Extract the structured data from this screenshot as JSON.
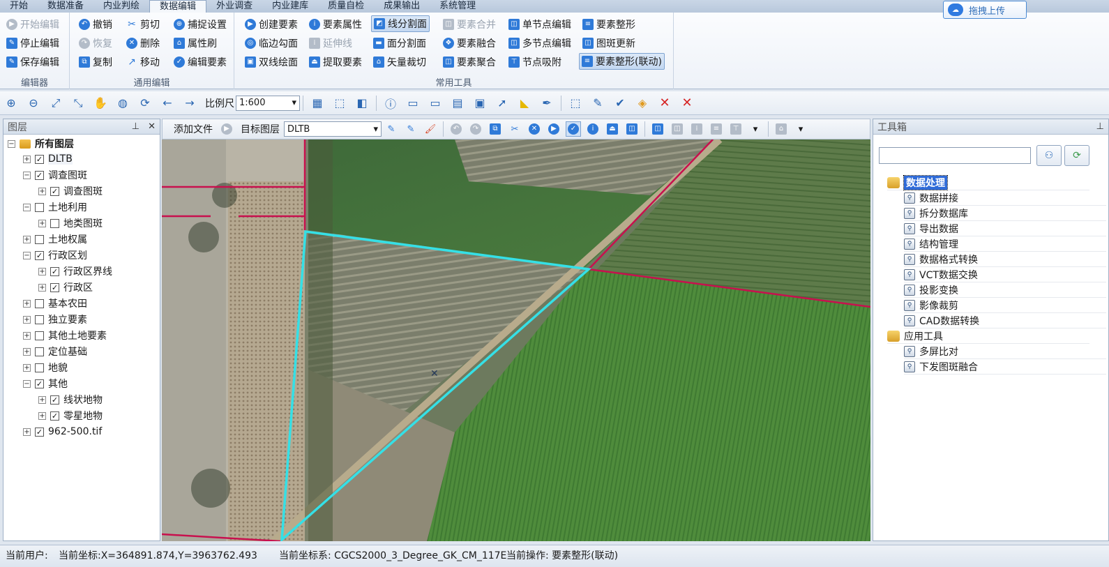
{
  "tabs": [
    "开始",
    "数据准备",
    "内业判绘",
    "数据编辑",
    "外业调查",
    "内业建库",
    "质量自检",
    "成果输出",
    "系统管理"
  ],
  "active_tab": "数据编辑",
  "upload_label": "拖拽上传",
  "ribbon": {
    "editor": {
      "title": "编辑器",
      "start": "开始编辑",
      "stop": "停止编辑",
      "save": "保存编辑"
    },
    "general": {
      "title": "通用编辑",
      "undo": "撤销",
      "redo": "恢复",
      "copy": "复制",
      "cut": "剪切",
      "delete": "删除",
      "move": "移动",
      "snap": "捕捉设置",
      "attr_brush": "属性刷",
      "edit_feature": "编辑要素"
    },
    "common": {
      "title": "常用工具",
      "create": "创建要素",
      "trace": "临边勾面",
      "double_line": "双线绘面",
      "feature_attr": "要素属性",
      "extend_line": "延伸线",
      "extract": "提取要素",
      "line_split": "线分割面",
      "face_split": "面分割面",
      "vector_clip": "矢量裁切",
      "merge": "要素合并",
      "fuse": "要素融合",
      "aggregate": "要素聚合",
      "single_node": "单节点编辑",
      "multi_node": "多节点编辑",
      "node_snap": "节点吸附",
      "reshape": "要素整形",
      "update": "图斑更新",
      "reshape_linked": "要素整形(联动)"
    }
  },
  "toolbar": {
    "scale_label": "比例尺",
    "scale_value": "1:600"
  },
  "layers_panel": {
    "title": "图层",
    "root": "所有图层",
    "items": [
      {
        "label": "DLTB",
        "level": 1,
        "checked": true,
        "expander": "+"
      },
      {
        "label": "调查图斑",
        "level": 1,
        "checked": true,
        "expander": "−"
      },
      {
        "label": "调查图斑",
        "level": 2,
        "checked": true,
        "expander": "+"
      },
      {
        "label": "土地利用",
        "level": 1,
        "checked": false,
        "expander": "−"
      },
      {
        "label": "地类图斑",
        "level": 2,
        "checked": false,
        "expander": "+"
      },
      {
        "label": "土地权属",
        "level": 1,
        "checked": false,
        "expander": "+"
      },
      {
        "label": "行政区划",
        "level": 1,
        "checked": true,
        "expander": "−"
      },
      {
        "label": "行政区界线",
        "level": 2,
        "checked": true,
        "expander": "+"
      },
      {
        "label": "行政区",
        "level": 2,
        "checked": true,
        "expander": "+"
      },
      {
        "label": "基本农田",
        "level": 1,
        "checked": false,
        "expander": "+"
      },
      {
        "label": "独立要素",
        "level": 1,
        "checked": false,
        "expander": "+"
      },
      {
        "label": "其他土地要素",
        "level": 1,
        "checked": false,
        "expander": "+"
      },
      {
        "label": "定位基础",
        "level": 1,
        "checked": false,
        "expander": "+"
      },
      {
        "label": "地貌",
        "level": 1,
        "checked": false,
        "expander": "+"
      },
      {
        "label": "其他",
        "level": 1,
        "checked": true,
        "expander": "−"
      },
      {
        "label": "线状地物",
        "level": 2,
        "checked": true,
        "expander": "+"
      },
      {
        "label": "零星地物",
        "level": 2,
        "checked": true,
        "expander": "+"
      },
      {
        "label": "962-500.tif",
        "level": 1,
        "checked": true,
        "expander": "+"
      }
    ]
  },
  "edit_bar": {
    "add_file": "添加文件",
    "target_label": "目标图层",
    "target_value": "DLTB"
  },
  "toolbox": {
    "title": "工具箱",
    "search_placeholder": "",
    "categories": [
      {
        "name": "数据处理",
        "tools": [
          "数据拼接",
          "拆分数据库",
          "导出数据",
          "结构管理",
          "数据格式转换",
          "VCT数据交换",
          "投影变换",
          "影像裁剪",
          "CAD数据转换"
        ]
      },
      {
        "name": "应用工具",
        "tools": [
          "多屏比对",
          "下发图斑融合"
        ]
      }
    ]
  },
  "status": {
    "user": "当前用户:",
    "coord": "当前坐标:X=364891.874,Y=3963762.493",
    "crs": "当前坐标系: CGCS2000_3_Degree_GK_CM_117E",
    "op": "当前操作: 要素整形(联动)"
  },
  "colors": {
    "boundary": "#c8104e",
    "selection": "#35e0e6"
  }
}
